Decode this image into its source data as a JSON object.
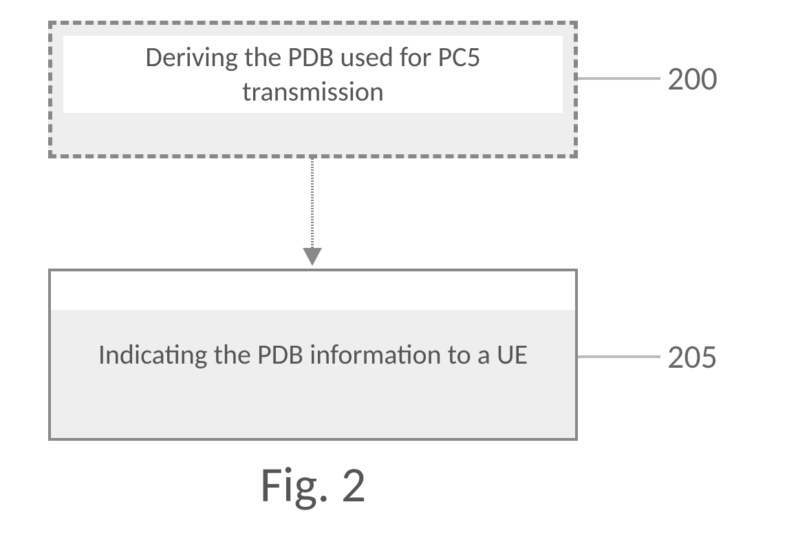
{
  "figure": {
    "caption": "Fig. 2",
    "steps": [
      {
        "ref": "200",
        "text": "Deriving the PDB used for PC5 transmission",
        "style": "dashed"
      },
      {
        "ref": "205",
        "text": "Indicating the PDB information to a UE",
        "style": "solid"
      }
    ]
  }
}
